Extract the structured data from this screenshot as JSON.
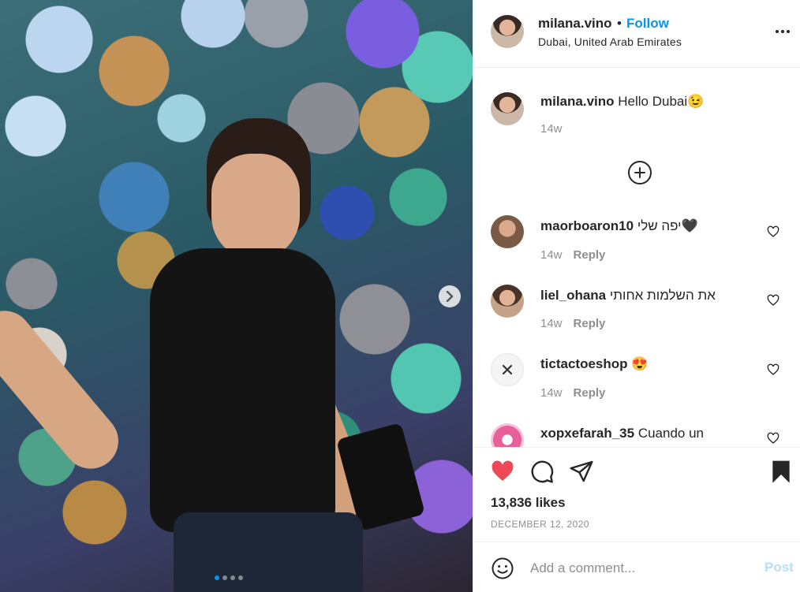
{
  "post": {
    "username": "milana.vino",
    "separator": "•",
    "follow_label": "Follow",
    "location": "Dubai, United Arab Emirates",
    "caption_user": "milana.vino",
    "caption_text": "Hello Dubai😉",
    "caption_time": "14w",
    "likes": "13,836 likes",
    "date": "DECEMBER 12, 2020",
    "carousel": {
      "slide_count": 4,
      "active_index": 0
    }
  },
  "comments": [
    {
      "user": "maorboaron10",
      "text": "יפה שלי🖤",
      "time": "14w",
      "reply_label": "Reply",
      "avatar_color": "#b5866a"
    },
    {
      "user": "liel_ohana",
      "text": "את השלמות אחותי",
      "time": "14w",
      "reply_label": "Reply",
      "avatar_color": "#c79a7c"
    },
    {
      "user": "tictactoeshop",
      "text": "😍",
      "time": "14w",
      "reply_label": "Reply",
      "avatar_color": "#f2f2f2"
    },
    {
      "user": "xopxefarah_35",
      "text": "Cuando un",
      "time": "",
      "reply_label": "",
      "avatar_color": "#e8609a"
    }
  ],
  "add_comment": {
    "placeholder": "Add a comment...",
    "post_label": "Post"
  },
  "colors": {
    "accent": "#0095f6",
    "like": "#ed4956",
    "muted": "#8e8e8e",
    "post_disabled": "#b2dffc"
  }
}
